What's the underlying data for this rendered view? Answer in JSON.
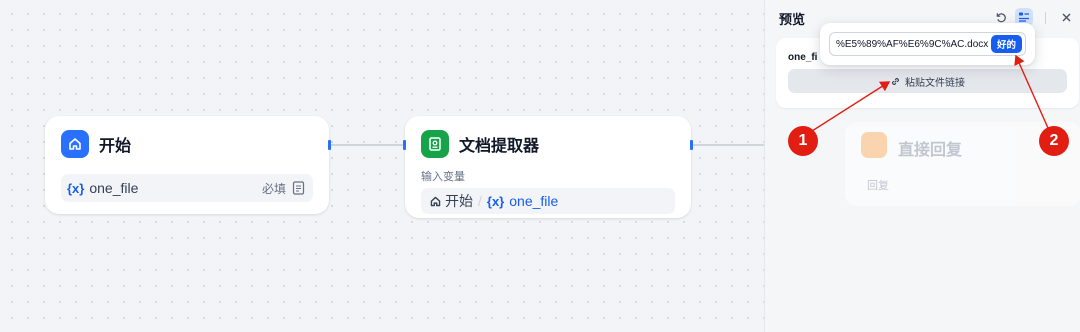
{
  "canvas": {
    "start_node": {
      "title": "开始",
      "variable": {
        "prefix": "{x}",
        "name": "one_file",
        "required_label": "必填"
      }
    },
    "extractor_node": {
      "title": "文档提取器",
      "input_label": "输入变量",
      "input_value": {
        "node": "开始",
        "separator": "/",
        "prefix": "{x}",
        "name": "one_file"
      }
    },
    "reply_node": {
      "title": "直接回复",
      "sub_label": "回复"
    }
  },
  "preview_panel": {
    "title": "预览",
    "field_label": "one_fi",
    "paste_button_label": "粘贴文件链接",
    "popover": {
      "url_value": "%E5%89%AF%E6%9C%AC.docx",
      "confirm_label": "好的"
    }
  },
  "annotations": {
    "marker_1": "1",
    "marker_2": "2",
    "color": "#e21e12"
  },
  "colors": {
    "accent": "#155eef",
    "start_icon_bg": "#2970ff",
    "extractor_icon_bg": "#16a34a",
    "edge": "#d0d5dd"
  }
}
